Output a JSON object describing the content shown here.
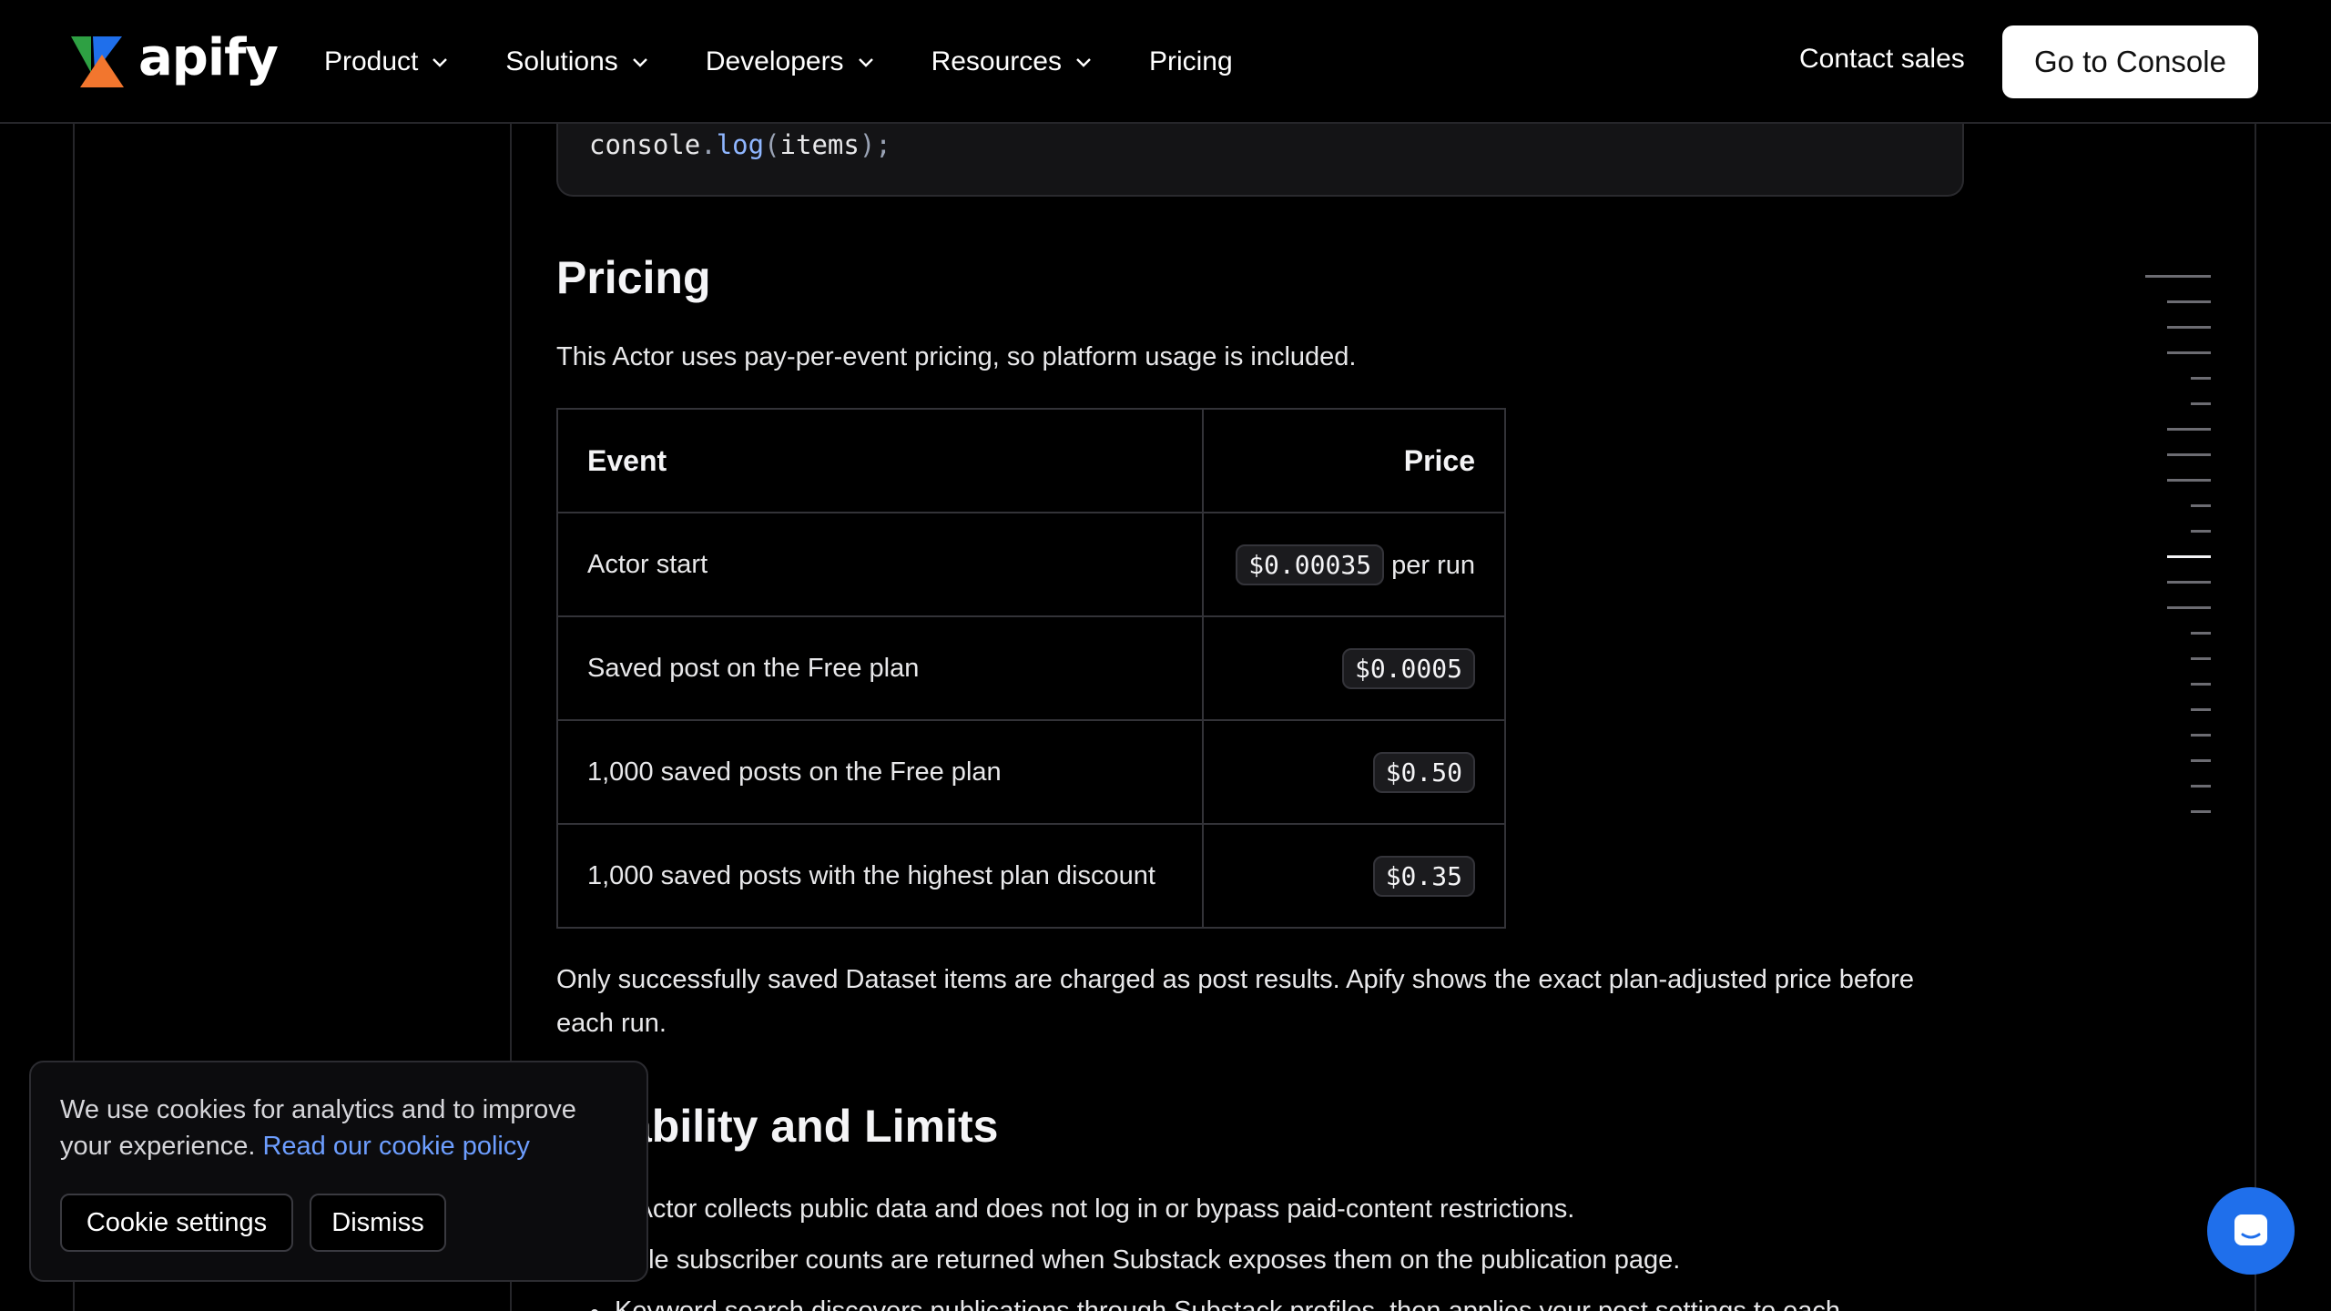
{
  "header": {
    "logo_text": "apify",
    "nav": [
      {
        "label": "Product",
        "has_dropdown": true
      },
      {
        "label": "Solutions",
        "has_dropdown": true
      },
      {
        "label": "Developers",
        "has_dropdown": true
      },
      {
        "label": "Resources",
        "has_dropdown": true
      },
      {
        "label": "Pricing",
        "has_dropdown": false
      }
    ],
    "contact_label": "Contact sales",
    "console_label": "Go to Console"
  },
  "code": {
    "object": "console",
    "dot": ".",
    "method": "log",
    "open": "(",
    "arg": "items",
    "close": ");"
  },
  "pricing": {
    "heading": "Pricing",
    "intro": "This Actor uses pay-per-event pricing, so platform usage is included.",
    "table": {
      "headers": [
        "Event",
        "Price"
      ],
      "rows": [
        {
          "event": "Actor start",
          "price": "$0.00035",
          "suffix": "per run"
        },
        {
          "event": "Saved post on the Free plan",
          "price": "$0.0005",
          "suffix": ""
        },
        {
          "event": "1,000 saved posts on the Free plan",
          "price": "$0.50",
          "suffix": ""
        },
        {
          "event": "1,000 saved posts with the highest plan discount",
          "price": "$0.35",
          "suffix": ""
        }
      ]
    },
    "note_line1": "Only successfully saved Dataset items are charged as post results. Apify shows the exact plan-adjusted price before",
    "note_line2": "each run."
  },
  "limits": {
    "heading": "ability and Limits",
    "items": [
      "e Actor collects public data and does not log in or bypass paid-content restrictions.",
      "sible subscriber counts are returned when Substack exposes them on the publication page.",
      "Keyword search discovers publications through Substack profiles, then applies your post settings to each"
    ]
  },
  "cookie": {
    "text": "We use cookies for analytics and to improve your experience.",
    "link": "Read our cookie policy",
    "settings_label": "Cookie settings",
    "dismiss_label": "Dismiss"
  },
  "icons": {
    "chevron": "chevron-down-icon",
    "chat": "chat-icon"
  },
  "colors": {
    "accent_blue": "#1f6feb",
    "link_blue": "#6d9eff",
    "logo_green": "#2ea043",
    "logo_blue": "#1f6feb",
    "logo_orange": "#f2762e"
  }
}
